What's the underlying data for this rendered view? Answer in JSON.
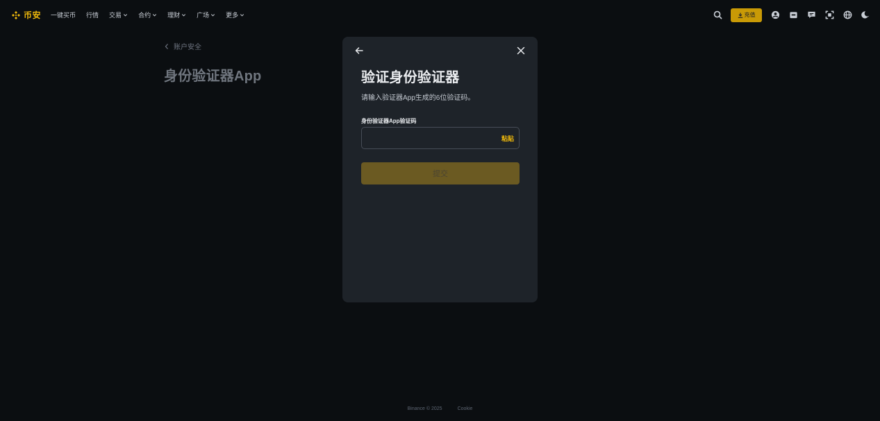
{
  "colors": {
    "brand": "#f0b90b",
    "background": "#0b0e11",
    "modal": "#1e2329",
    "submit_disabled": "#6b5a22"
  },
  "header": {
    "logo_text": "币安",
    "nav": [
      {
        "label": "一键买币",
        "dropdown": false
      },
      {
        "label": "行情",
        "dropdown": false
      },
      {
        "label": "交易",
        "dropdown": true
      },
      {
        "label": "合约",
        "dropdown": true
      },
      {
        "label": "理财",
        "dropdown": true
      },
      {
        "label": "广场",
        "dropdown": true
      },
      {
        "label": "更多",
        "dropdown": true
      }
    ],
    "deposit_label": "充值",
    "tool_icons": [
      "search-icon",
      "download-icon",
      "user-icon",
      "wallet-icon",
      "message-icon",
      "scan-icon",
      "globe-icon",
      "moon-icon"
    ]
  },
  "page": {
    "breadcrumb": "账户安全",
    "title": "身份验证器App"
  },
  "modal": {
    "title": "验证身份验证器",
    "description": "请输入验证器App生成的6位验证码。",
    "field_label": "身份验证器App验证码",
    "field_value": "",
    "field_placeholder": "",
    "paste_label": "粘贴",
    "submit_label": "提交"
  },
  "footer": {
    "copyright": "Binance © 2025",
    "cookie": "Cookie"
  }
}
